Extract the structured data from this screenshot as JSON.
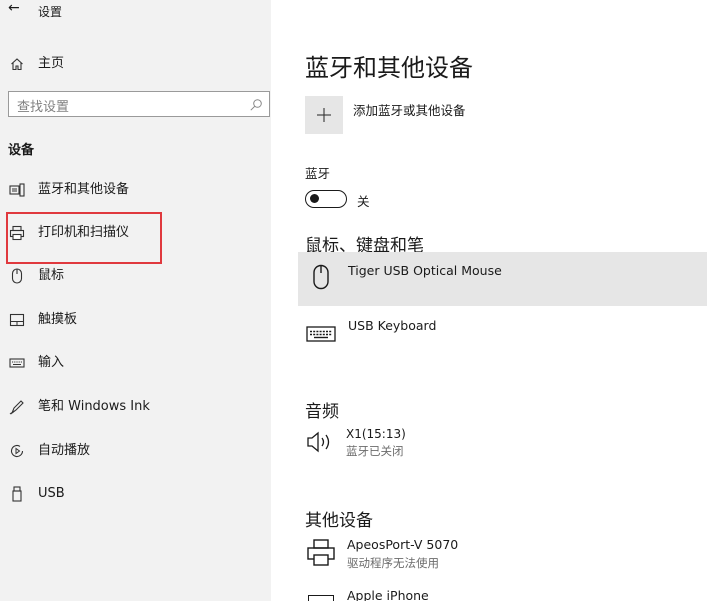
{
  "header": {
    "back_label": "←",
    "title": "设置"
  },
  "sidebar": {
    "home_label": "主页",
    "search_placeholder": "查找设置",
    "section_title": "设备",
    "items": [
      {
        "label": "蓝牙和其他设备",
        "icon": "bluetooth-devices-icon"
      },
      {
        "label": "打印机和扫描仪",
        "icon": "printer-icon"
      },
      {
        "label": "鼠标",
        "icon": "mouse-icon"
      },
      {
        "label": "触摸板",
        "icon": "touchpad-icon"
      },
      {
        "label": "输入",
        "icon": "keyboard-icon"
      },
      {
        "label": "笔和 Windows Ink",
        "icon": "pen-icon"
      },
      {
        "label": "自动播放",
        "icon": "autoplay-icon"
      },
      {
        "label": "USB",
        "icon": "usb-icon"
      }
    ]
  },
  "main": {
    "page_title": "蓝牙和其他设备",
    "add_device_label": "添加蓝牙或其他设备",
    "bluetooth": {
      "label": "蓝牙",
      "state_label": "关"
    },
    "mouse_section": {
      "title": "鼠标、键盘和笔",
      "devices": [
        {
          "name": "Tiger USB Optical Mouse",
          "icon": "mouse-icon"
        },
        {
          "name": "USB Keyboard",
          "icon": "keyboard-icon"
        }
      ]
    },
    "audio_section": {
      "title": "音频",
      "device": {
        "name": "X1(15:13)",
        "status": "蓝牙已关闭",
        "icon": "speaker-icon"
      }
    },
    "other_section": {
      "title": "其他设备",
      "devices": [
        {
          "name": "ApeosPort-V 5070",
          "status": "驱动程序无法使用",
          "icon": "printer-icon"
        },
        {
          "name": "Apple iPhone",
          "icon": "phone-icon"
        }
      ]
    }
  },
  "colors": {
    "highlight_border": "#e0393e",
    "selected_row": "#e6e6e6",
    "sidebar_bg": "#f2f2f2"
  }
}
